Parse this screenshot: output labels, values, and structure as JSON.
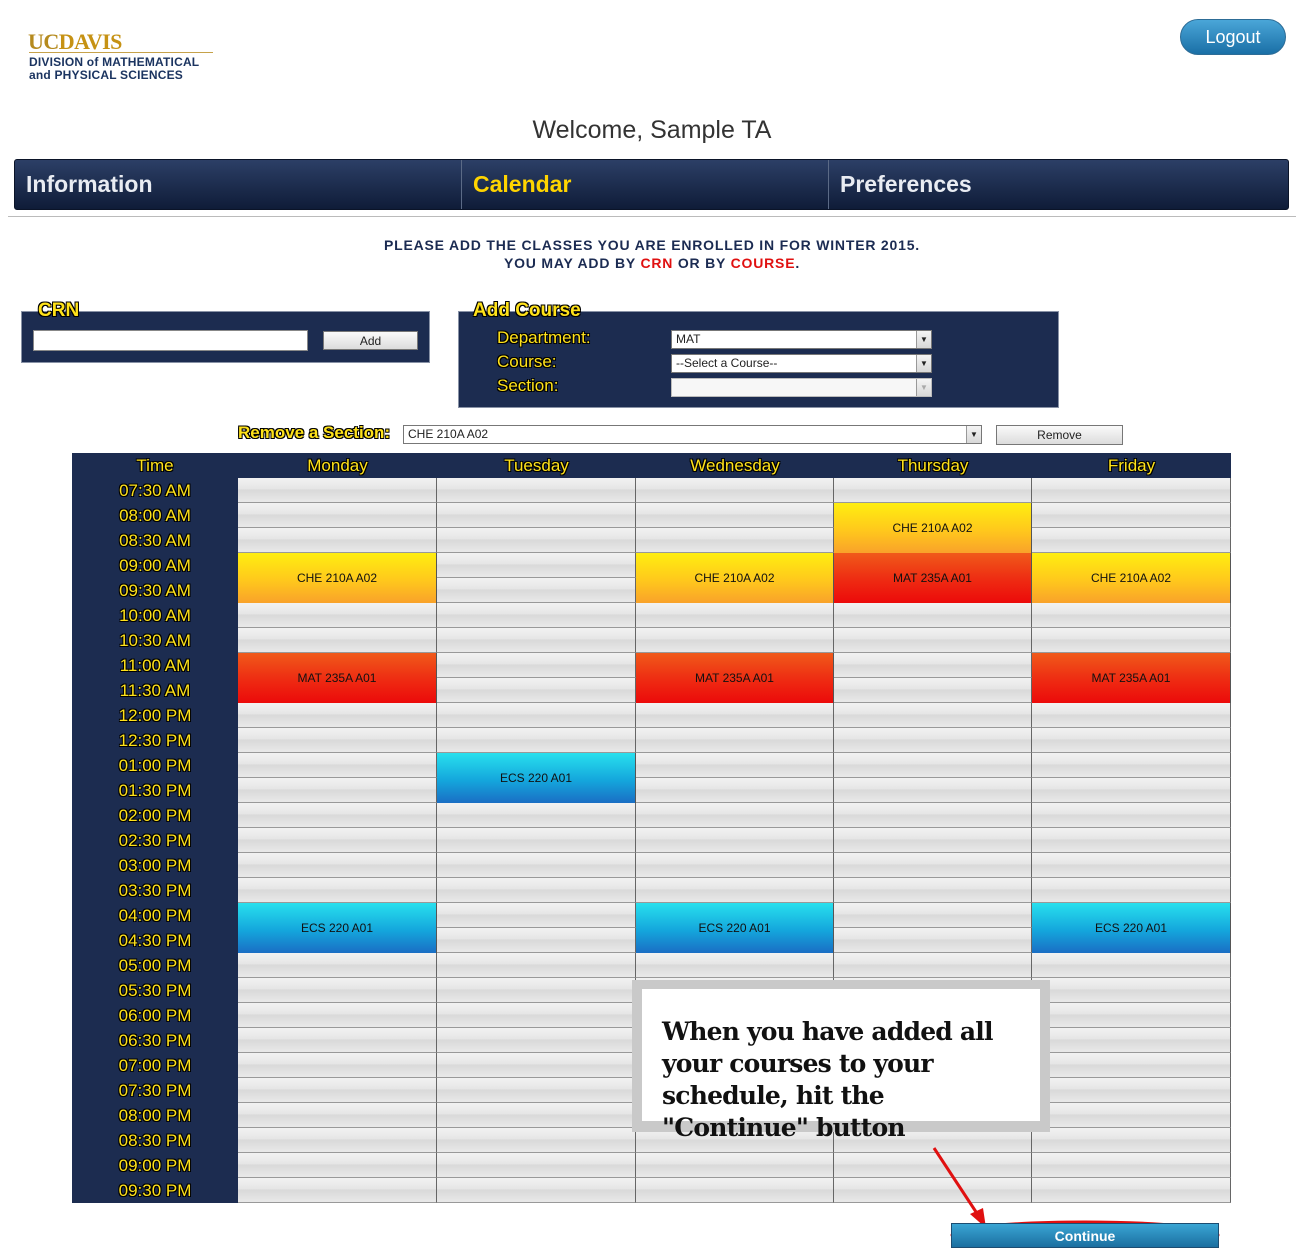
{
  "logo": {
    "uc": "UC",
    "davis": "DAVIS",
    "line1": "DIVISION of MATHEMATICAL",
    "line2": "and PHYSICAL SCIENCES"
  },
  "logout_label": "Logout",
  "welcome": "Welcome, Sample TA",
  "nav": {
    "tabs": [
      {
        "label": "Information",
        "active": false
      },
      {
        "label": "Calendar",
        "active": true
      },
      {
        "label": "Preferences",
        "active": false
      }
    ]
  },
  "instructions": {
    "line1": "PLEASE ADD THE CLASSES YOU ARE ENROLLED IN FOR WINTER 2015.",
    "line2_pre": "YOU MAY ADD BY ",
    "crn": "CRN",
    "line2_mid": " OR BY ",
    "course": "COURSE",
    "line2_end": "."
  },
  "crn_panel": {
    "legend": "CRN",
    "input_value": "",
    "add_label": "Add"
  },
  "add_course": {
    "legend": "Add Course",
    "department_label": "Department:",
    "department_value": "MAT",
    "course_label": "Course:",
    "course_value": "--Select a Course--",
    "section_label": "Section:",
    "section_value": ""
  },
  "remove": {
    "label": "Remove a Section:",
    "value": "CHE 210A A02",
    "button": "Remove"
  },
  "calendar": {
    "headers": [
      "Time",
      "Monday",
      "Tuesday",
      "Wednesday",
      "Thursday",
      "Friday"
    ],
    "times": [
      "07:30 AM",
      "08:00 AM",
      "08:30 AM",
      "09:00 AM",
      "09:30 AM",
      "10:00 AM",
      "10:30 AM",
      "11:00 AM",
      "11:30 AM",
      "12:00 PM",
      "12:30 PM",
      "01:00 PM",
      "01:30 PM",
      "02:00 PM",
      "02:30 PM",
      "03:00 PM",
      "03:30 PM",
      "04:00 PM",
      "04:30 PM",
      "05:00 PM",
      "05:30 PM",
      "06:00 PM",
      "06:30 PM",
      "07:00 PM",
      "07:30 PM",
      "08:00 PM",
      "08:30 PM",
      "09:00 PM",
      "09:30 PM"
    ],
    "events": [
      {
        "label": "CHE 210A A02",
        "day": 0,
        "start": "09:00 AM",
        "slots": 2,
        "color": "yellow"
      },
      {
        "label": "CHE 210A A02",
        "day": 2,
        "start": "09:00 AM",
        "slots": 2,
        "color": "yellow"
      },
      {
        "label": "CHE 210A A02",
        "day": 3,
        "start": "08:00 AM",
        "slots": 2,
        "color": "yellow"
      },
      {
        "label": "CHE 210A A02",
        "day": 4,
        "start": "09:00 AM",
        "slots": 2,
        "color": "yellow"
      },
      {
        "label": "MAT 235A A01",
        "day": 3,
        "start": "09:00 AM",
        "slots": 2,
        "color": "red"
      },
      {
        "label": "MAT 235A A01",
        "day": 0,
        "start": "11:00 AM",
        "slots": 2,
        "color": "red"
      },
      {
        "label": "MAT 235A A01",
        "day": 2,
        "start": "11:00 AM",
        "slots": 2,
        "color": "red"
      },
      {
        "label": "MAT 235A A01",
        "day": 4,
        "start": "11:00 AM",
        "slots": 2,
        "color": "red"
      },
      {
        "label": "ECS 220 A01",
        "day": 1,
        "start": "01:00 PM",
        "slots": 2,
        "color": "blue"
      },
      {
        "label": "ECS 220 A01",
        "day": 0,
        "start": "04:00 PM",
        "slots": 2,
        "color": "blue"
      },
      {
        "label": "ECS 220 A01",
        "day": 2,
        "start": "04:00 PM",
        "slots": 2,
        "color": "blue"
      },
      {
        "label": "ECS 220 A01",
        "day": 4,
        "start": "04:00 PM",
        "slots": 2,
        "color": "blue"
      }
    ]
  },
  "callout": "When you have added all your courses to your schedule, hit the \"Continue\" button",
  "continue_label": "Continue",
  "colors": {
    "navy": "#1c2c50",
    "gold": "#ffe21a",
    "accent_red": "#e01010",
    "button_blue": "#1b6fa0"
  }
}
